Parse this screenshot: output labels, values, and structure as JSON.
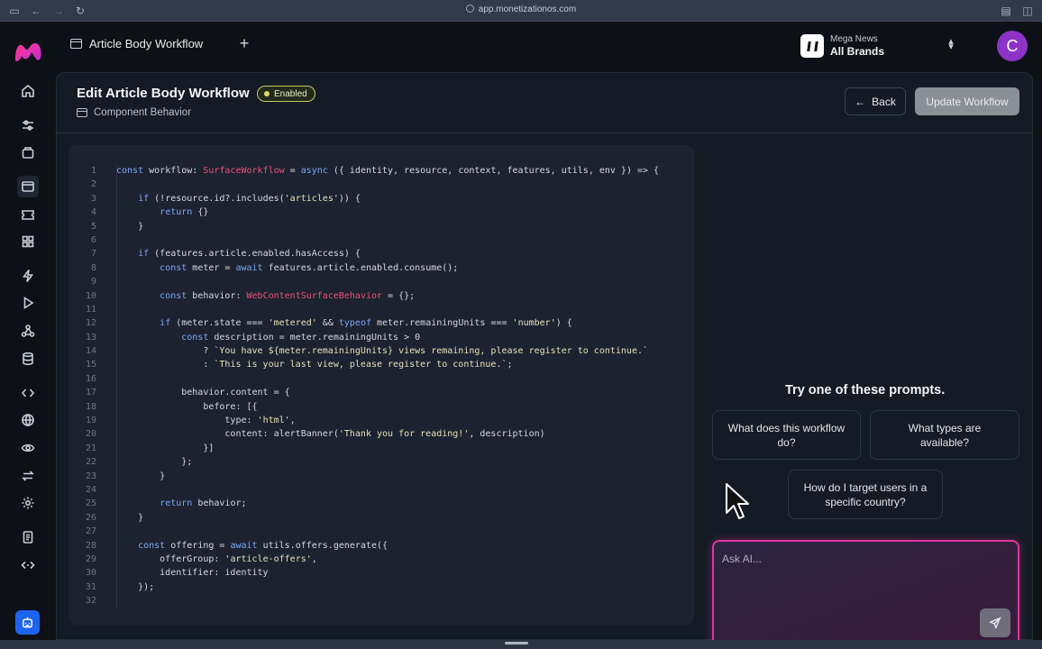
{
  "browser": {
    "url": "app.monetizationos.com"
  },
  "topbar": {
    "tab_label": "Article Body Workflow",
    "brand_small": "Mega News",
    "brand_big": "All Brands",
    "avatar_letter": "C"
  },
  "page": {
    "title": "Edit Article Body Workflow",
    "status": "Enabled",
    "subtitle": "Component Behavior",
    "back_label": "Back",
    "update_label": "Update Workflow"
  },
  "code": {
    "lines": [
      "const workflow: SurfaceWorkflow = async ({ identity, resource, context, features, utils, env }) => {",
      "",
      "    if (!resource.id?.includes('articles')) {",
      "        return {}",
      "    }",
      "",
      "    if (features.article.enabled.hasAccess) {",
      "        const meter = await features.article.enabled.consume();",
      "",
      "        const behavior: WebContentSurfaceBehavior = {};",
      "",
      "        if (meter.state === 'metered' && typeof meter.remainingUnits === 'number') {",
      "            const description = meter.remainingUnits > 0",
      "                ? `You have ${meter.remainingUnits} views remaining, please register to continue.`",
      "                : `This is your last view, please register to continue.`;",
      "",
      "            behavior.content = {",
      "                before: [{",
      "                    type: 'html',",
      "                    content: alertBanner('Thank you for reading!', description)",
      "                }]",
      "            };",
      "        }",
      "",
      "        return behavior;",
      "    }",
      "",
      "    const offering = await utils.offers.generate({",
      "        offerGroup: 'article-offers',",
      "        identifier: identity",
      "    });",
      ""
    ]
  },
  "ai": {
    "prompts_title": "Try one of these prompts.",
    "prompts": [
      "What does this workflow do?",
      "What types are available?",
      "How do I target users in a specific country?"
    ],
    "input_placeholder": "Ask AI..."
  },
  "colors": {
    "accent": "#e0359a",
    "avatar": "#8e33c7",
    "status": "#d9dd6b",
    "bottom_button": "#1e63f0"
  }
}
